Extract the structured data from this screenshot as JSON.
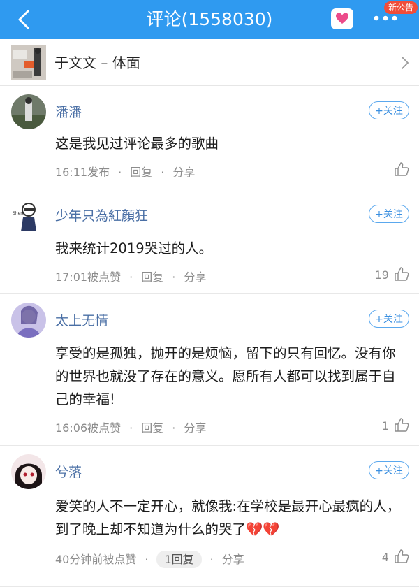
{
  "header": {
    "title": "评论(1558030)",
    "notice_badge": "新公告",
    "accent_color": "#2f9af0",
    "back_icon": "chevron-left-icon",
    "heart_icon": "heart-icon",
    "more_icon": "more-icon"
  },
  "song": {
    "name": "于文文 – 体面",
    "arrow_icon": "chevron-right-icon"
  },
  "comments": [
    {
      "user": "潘潘",
      "follow_label": "+关注",
      "content": "这是我见过评论最多的歌曲",
      "time": "16:11发布",
      "reply_label": "回复",
      "share_label": "分享",
      "likes": ""
    },
    {
      "user": "少年只為紅顏狂",
      "follow_label": "+关注",
      "content": "我来统计2019哭过的人。",
      "time": "17:01被点赞",
      "reply_label": "回复",
      "share_label": "分享",
      "likes": "19"
    },
    {
      "user": "太上无情",
      "follow_label": "+关注",
      "content": "享受的是孤独，抛开的是烦恼，留下的只有回忆。没有你的世界也就没了存在的意义。愿所有人都可以找到属于自己的幸福!",
      "time": "16:06被点赞",
      "reply_label": "回复",
      "share_label": "分享",
      "likes": "1"
    },
    {
      "user": "兮落",
      "follow_label": "+关注",
      "content": "爱笑的人不一定开心，就像我:在学校是最开心最疯的人，到了晚上却不知道为什么的哭了💔💔",
      "time": "40分钟前被点赞",
      "reply_label": "1回复",
      "share_label": "分享",
      "likes": "4"
    }
  ]
}
